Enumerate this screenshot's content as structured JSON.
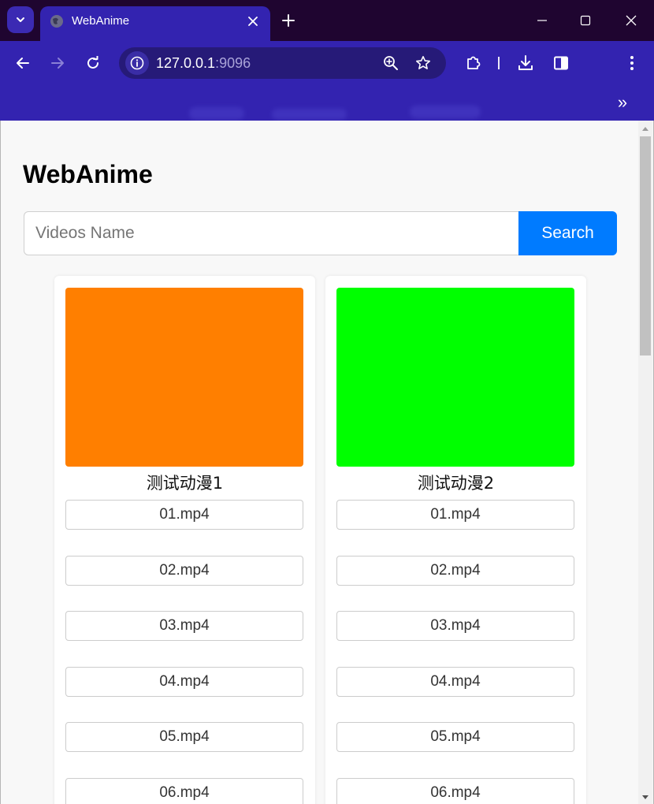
{
  "browser": {
    "tab_title": "WebAnime",
    "url_host": "127.0.0.1",
    "url_port": ":9096",
    "bookmarks_more": "»"
  },
  "page": {
    "title": "WebAnime",
    "search": {
      "placeholder": "Videos Name",
      "value": "",
      "button_label": "Search"
    }
  },
  "colors": {
    "accent": "#007bff",
    "browser_theme": "#3323b0"
  },
  "anime": [
    {
      "title": "测试动漫1",
      "cover_color": "#ff7f00",
      "episodes": [
        "01.mp4",
        "02.mp4",
        "03.mp4",
        "04.mp4",
        "05.mp4",
        "06.mp4"
      ]
    },
    {
      "title": "测试动漫2",
      "cover_color": "#00ff00",
      "episodes": [
        "01.mp4",
        "02.mp4",
        "03.mp4",
        "04.mp4",
        "05.mp4",
        "06.mp4"
      ]
    }
  ]
}
